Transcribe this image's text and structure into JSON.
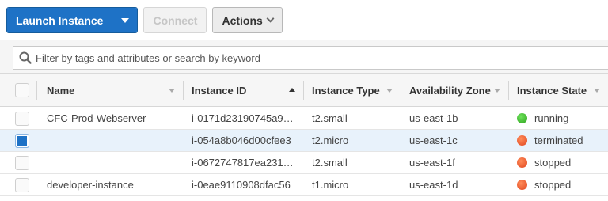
{
  "toolbar": {
    "launch_label": "Launch Instance",
    "connect_label": "Connect",
    "actions_label": "Actions"
  },
  "search": {
    "placeholder": "Filter by tags and attributes or search by keyword"
  },
  "table": {
    "columns": [
      "Name",
      "Instance ID",
      "Instance Type",
      "Availability Zone",
      "Instance State"
    ],
    "sorted_column": "Instance ID",
    "sort_direction": "ascending",
    "rows": [
      {
        "name": "CFC-Prod-Webserver",
        "id": "i-0171d23190745a9…",
        "type": "t2.small",
        "az": "us-east-1b",
        "state": "running",
        "state_color": "#2ea11f",
        "selected": false
      },
      {
        "name": "",
        "id": "i-054a8b046d00cfee3",
        "type": "t2.micro",
        "az": "us-east-1c",
        "state": "terminated",
        "state_color": "#e0451e",
        "selected": true
      },
      {
        "name": "",
        "id": "i-0672747817ea231…",
        "type": "t2.small",
        "az": "us-east-1f",
        "state": "stopped",
        "state_color": "#e0451e",
        "selected": false
      },
      {
        "name": "developer-instance",
        "id": "i-0eae9110908dfac56",
        "type": "t1.micro",
        "az": "us-east-1d",
        "state": "stopped",
        "state_color": "#e0451e",
        "selected": false
      }
    ]
  },
  "colors": {
    "primary": "#1e72c6",
    "selected_row": "#e8f2fb",
    "running": "#2ea11f",
    "stopped": "#e0451e"
  }
}
